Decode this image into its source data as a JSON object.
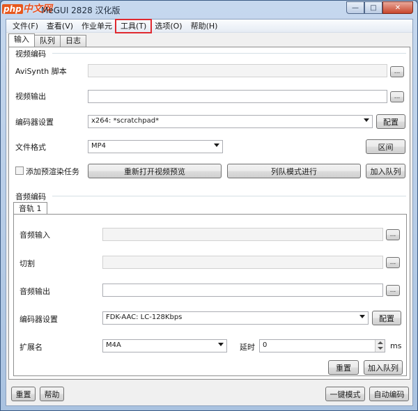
{
  "window": {
    "title": "MeGUI 2828 汉化版",
    "watermark_php": "php",
    "watermark_cn": "中文网",
    "min_glyph": "—",
    "max_glyph": "□",
    "close_glyph": "✕"
  },
  "menu": [
    "文件(F)",
    "查看(V)",
    "作业单元",
    "工具(T)",
    "选项(O)",
    "帮助(H)"
  ],
  "tabs": [
    "输入",
    "队列",
    "日志"
  ],
  "video": {
    "group_title": "视频编码",
    "avisynth_label": "AviSynth 脚本",
    "avisynth_value": "",
    "output_label": "视频输出",
    "output_value": "",
    "encoder_label": "编码器设置",
    "encoder_value": "x264: *scratchpad*",
    "config_button": "配置",
    "format_label": "文件格式",
    "format_value": "MP4",
    "range_button": "区间",
    "add_prerender_label": "添加预渲染任务",
    "reopen_preview_button": "重新打开视频预览",
    "queue_mode_button": "列队模式进行",
    "add_queue_button": "加入队列",
    "browse_glyph": "..."
  },
  "audio": {
    "group_title": "音频编码",
    "track_tab": "音轨 1",
    "input_label": "音频输入",
    "input_value": "",
    "cut_label": "切割",
    "cut_value": "",
    "output_label": "音频输出",
    "output_value": "",
    "encoder_label": "编码器设置",
    "encoder_value": "FDK-AAC: LC-128Kbps",
    "config_button": "配置",
    "ext_label": "扩展名",
    "ext_value": "M4A",
    "delay_label": "延时",
    "delay_value": "0",
    "delay_unit": "ms",
    "reset_button": "重置",
    "add_queue_button": "加入队列",
    "browse_glyph": "..."
  },
  "footer": {
    "reset_button": "重置",
    "help_button": "帮助",
    "oneclick_button": "一键模式",
    "autoencode_button": "自动编码"
  }
}
